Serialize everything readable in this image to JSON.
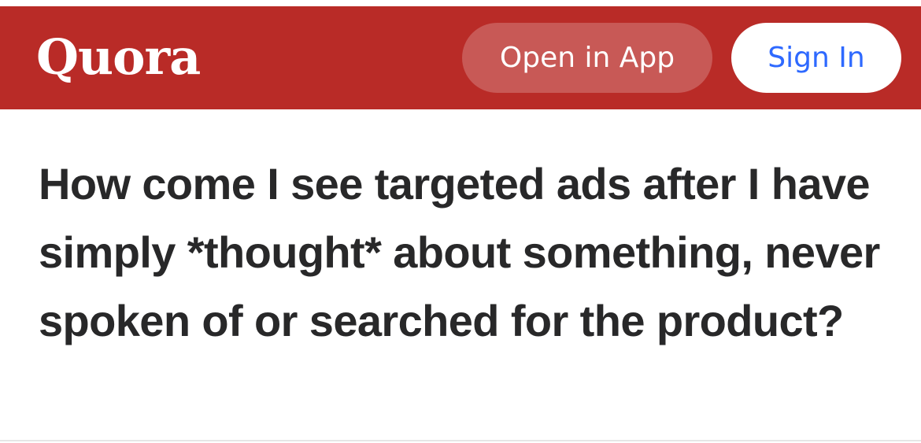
{
  "colors": {
    "brand": "#b92b27",
    "top_strip": "#ffffff",
    "sign_in_text": "#2e69ff",
    "question_text": "#282829"
  },
  "header": {
    "logo": "Quora",
    "open_in_app_label": "Open in App",
    "sign_in_label": "Sign In"
  },
  "question": {
    "title": "How come I see targeted ads after I have simply *thought* about something, never spoken of or searched for the product?"
  }
}
